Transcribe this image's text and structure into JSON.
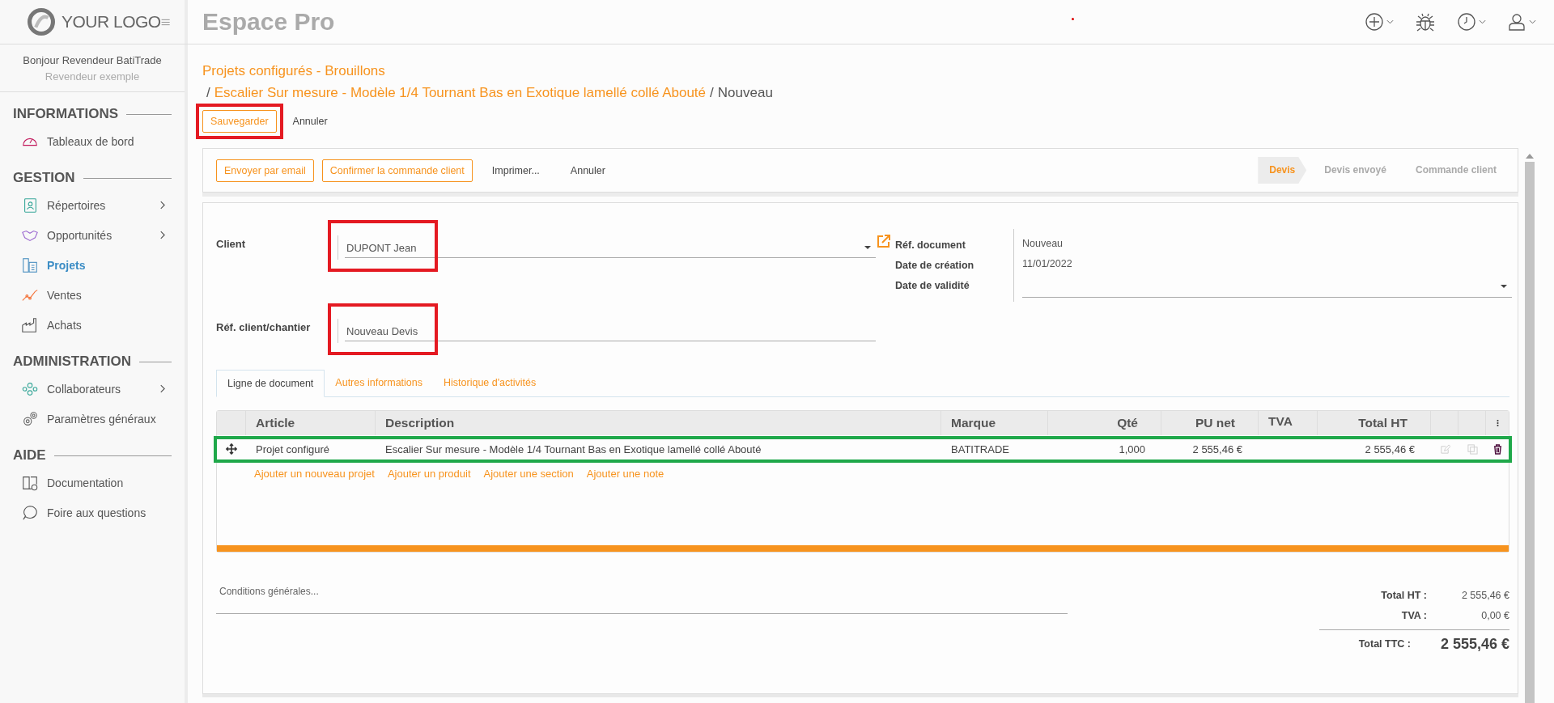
{
  "header": {
    "logo": "YOUR LOGO",
    "title": "Espace Pro"
  },
  "user": {
    "greeting": "Bonjour Revendeur BatiTrade",
    "role": "Revendeur exemple"
  },
  "sidebar": {
    "sections": [
      {
        "title": "INFORMATIONS",
        "items": [
          {
            "label": "Tableaux de bord",
            "selected": false,
            "expandable": false
          }
        ]
      },
      {
        "title": "GESTION",
        "items": [
          {
            "label": "Répertoires",
            "selected": false,
            "expandable": true
          },
          {
            "label": "Opportunités",
            "selected": false,
            "expandable": true
          },
          {
            "label": "Projets",
            "selected": true,
            "expandable": false
          },
          {
            "label": "Ventes",
            "selected": false,
            "expandable": false
          },
          {
            "label": "Achats",
            "selected": false,
            "expandable": false
          }
        ]
      },
      {
        "title": "ADMINISTRATION",
        "items": [
          {
            "label": "Collaborateurs",
            "selected": false,
            "expandable": true
          },
          {
            "label": "Paramètres généraux",
            "selected": false,
            "expandable": false
          }
        ]
      },
      {
        "title": "AIDE",
        "items": [
          {
            "label": "Documentation",
            "selected": false,
            "expandable": false
          },
          {
            "label": "Foire aux questions",
            "selected": false,
            "expandable": false
          }
        ]
      }
    ]
  },
  "breadcrumb": {
    "parent": "Projets configurés - Brouillons",
    "separator": "/",
    "item": "Escalier Sur mesure - Modèle 1/4 Tournant Bas en Exotique lamellé collé Abouté",
    "separator_2": "/",
    "current": "Nouveau"
  },
  "actions": {
    "save": {
      "label": "Sauvegarder",
      "color": "#e41a22"
    },
    "cancel": "Annuler"
  },
  "toolbar": {
    "buttons": [
      {
        "label": "Envoyer par email",
        "kind": "outlined"
      },
      {
        "label": "Confirmer la commande client",
        "kind": "outlined"
      },
      {
        "label": "Imprimer...",
        "kind": "plain"
      },
      {
        "label": "Annuler",
        "kind": "plain"
      }
    ],
    "steps": [
      {
        "label": "Devis",
        "selected": true
      },
      {
        "label": "Devis envoyé",
        "selected": false
      },
      {
        "label": "Commande client",
        "selected": false
      }
    ]
  },
  "form": {
    "client": {
      "label": "Client",
      "value": "DUPONT Jean",
      "color": "#e41a22"
    },
    "reference": {
      "label": "Réf. client/chantier",
      "value": "Nouveau Devis",
      "color": "#e41a22"
    },
    "meta": [
      {
        "label": "Réf. document",
        "value": "Nouveau"
      },
      {
        "label": "Date de création",
        "value": "11/01/2022"
      },
      {
        "label": "Date de validité"
      }
    ]
  },
  "tabs": [
    {
      "label": "Ligne de document",
      "selected": true
    },
    {
      "label": "Autres informations",
      "selected": false
    },
    {
      "label": "Historique d'activités",
      "selected": false
    }
  ],
  "table": {
    "columns": [
      "Article",
      "Description",
      "Marque",
      "Qté",
      "PU net",
      "TVA",
      "Total HT"
    ],
    "rows": [
      {
        "article": "Projet configuré",
        "description": "Escalier Sur mesure - Modèle 1/4 Tournant Bas en Exotique lamellé collé Abouté",
        "brand": "BATITRADE",
        "qty": "1,000",
        "unit_price": "2 555,46 €",
        "total": "2 555,46 €",
        "color": "#1fa84a"
      }
    ],
    "add_links": [
      "Ajouter un nouveau projet",
      "Ajouter un produit",
      "Ajouter une section",
      "Ajouter une note"
    ]
  },
  "conditions": {
    "placeholder": "Conditions générales..."
  },
  "totals": [
    {
      "label": "Total HT :",
      "value": "2 555,46 €",
      "kind": "normal"
    },
    {
      "label": "TVA :",
      "value": "0,00 €",
      "kind": "normal"
    },
    {
      "label": "Total TTC :",
      "value": "2 555,46 €",
      "kind": "grand"
    }
  ]
}
